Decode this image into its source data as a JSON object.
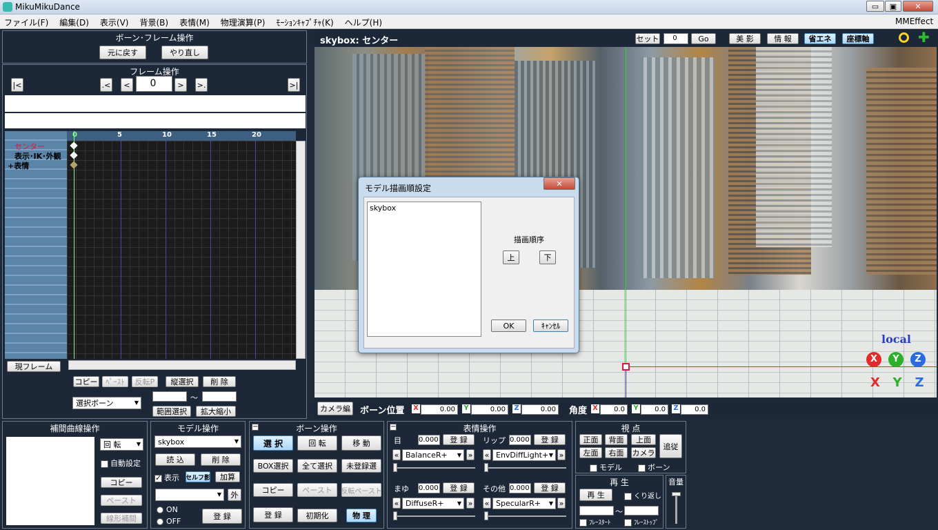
{
  "app": {
    "title": "MikuMikuDance",
    "mmeffect": "MMEffect",
    "min": "▭",
    "max": "▣",
    "close": "✕"
  },
  "menu": [
    "ファイル(F)",
    "編集(D)",
    "表示(V)",
    "背景(B)",
    "表情(M)",
    "物理演算(P)",
    "ﾓｰｼｮﾝｷｬﾌﾟﾁｬ(K)",
    "ヘルプ(H)"
  ],
  "bone_frame": {
    "title": "ボーン･フレーム操作",
    "undo": "元に戻す",
    "redo": "やり直し"
  },
  "frame_op": {
    "title": "フレーム操作",
    "first": "|<",
    "prev_key": ".<",
    "prev": "<",
    "frame": "0",
    "next": ">",
    "next_key": ">.",
    "last": ">|"
  },
  "timeline": {
    "ticks": [
      "0",
      "5",
      "10",
      "15",
      "20"
    ],
    "tracks": [
      {
        "label": "センター",
        "color": "#e0143c"
      },
      {
        "label": "表示･IK･外観",
        "color": "#000000"
      },
      {
        "label": "+表情",
        "color": "#000000"
      }
    ],
    "current_frame": "現フレーム"
  },
  "edit_row": {
    "copy": "コピー",
    "paste": "ﾍﾟｰｽﾄ",
    "reverse": "反転P",
    "vselect": "縦選択",
    "delete": "削 除"
  },
  "range": {
    "select": "選択ボーン",
    "tilde": "～",
    "range_select": "範囲選択",
    "scale": "拡大縮小"
  },
  "viewport": {
    "title": "skybox: センター",
    "set": "セット",
    "frame_val": "0",
    "go": "Go",
    "beauty": "美 影",
    "info": "情 報",
    "eco": "省エネ",
    "axis": "座標軸",
    "local": "local",
    "axis_letters": [
      "X",
      "Y",
      "Z"
    ]
  },
  "dialog": {
    "title": "モデル描画順設定",
    "list": [
      "skybox"
    ],
    "order_label": "描画順序",
    "up": "上",
    "down": "下",
    "ok": "OK",
    "cancel": "ｷｬﾝｾﾙ",
    "close": "✕"
  },
  "pos_bar": {
    "camera": "カメラ編",
    "bone_pos": "ボーン位置",
    "angle": "角度",
    "x": "0.00",
    "y": "0.00",
    "z": "0.00",
    "ax": "0.0",
    "ay": "0.0",
    "az": "0.0",
    "X": "X",
    "Y": "Y",
    "Z": "Z"
  },
  "interp": {
    "title": "補間曲線操作",
    "rotate": "回 転",
    "auto": "自動設定",
    "copy": "コピー",
    "paste": "ペースト",
    "linear": "線形補間"
  },
  "model_op": {
    "title": "モデル操作",
    "model": "skybox",
    "load": "読 込",
    "delete": "削 除",
    "show": "表示",
    "self_shadow": "セルフ影",
    "add": "加算",
    "outer": "外",
    "on": "ON",
    "off": "OFF",
    "register": "登 録"
  },
  "bone_op": {
    "title": "ボーン操作",
    "select": "選 択",
    "rotate": "回 転",
    "move": "移 動",
    "box": "BOX選択",
    "all": "全て選択",
    "unreg": "未登録選",
    "copy": "コピー",
    "paste": "ペースト",
    "rev_paste": "反転ペースト",
    "register": "登 録",
    "init": "初期化",
    "physics": "物 理"
  },
  "face_op": {
    "title": "表情操作",
    "eye": "目",
    "lip": "リップ",
    "brow": "まゆ",
    "other": "その他",
    "val": "0.000",
    "register": "登 録",
    "eye_morph": "BalanceR+",
    "lip_morph": "EnvDiffLight+",
    "brow_morph": "DiffuseR+",
    "other_morph": "SpecularR+"
  },
  "view": {
    "title": "視 点",
    "front": "正面",
    "back": "背面",
    "top": "上面",
    "left": "左面",
    "right": "右面",
    "camera": "カメラ",
    "follow": "追従",
    "model": "モデル",
    "bone": "ボーン"
  },
  "play": {
    "title": "再 生",
    "play": "再 生",
    "loop": "くり返し",
    "tilde": "～",
    "start": "ﾌﾚｰｽﾀｰﾄ",
    "stop": "ﾌﾚｰｽﾄｯﾌﾟ"
  },
  "volume": {
    "title": "音量"
  }
}
